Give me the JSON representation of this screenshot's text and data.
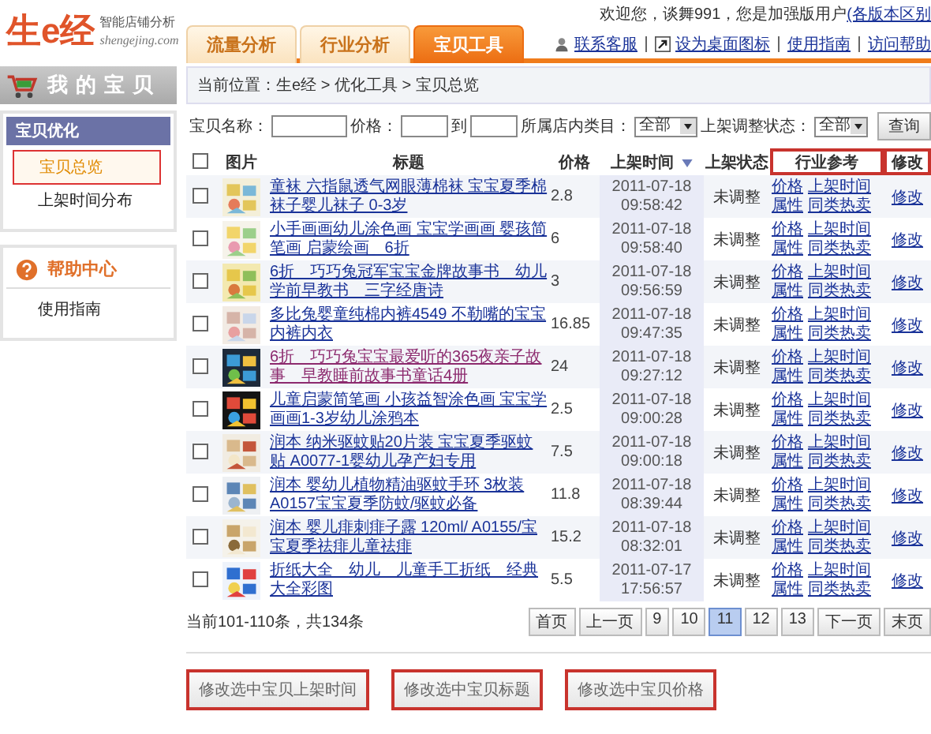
{
  "logo": {
    "name": "生e经",
    "tagline": "智能店铺分析",
    "domain": "shengejing.com"
  },
  "user_bar": {
    "welcome": "欢迎您，谈舞991，您是加强版用户",
    "link": "(各版本区别"
  },
  "top_links": [
    {
      "label": "联系客服",
      "kind": "contact"
    },
    {
      "label": "设为桌面图标",
      "kind": "shortcut"
    },
    {
      "label": "使用指南",
      "kind": "plain"
    },
    {
      "label": "访问帮助",
      "kind": "plain"
    }
  ],
  "tabs": [
    {
      "label": "流量分析",
      "selected": false
    },
    {
      "label": "行业分析",
      "selected": false
    },
    {
      "label": "宝贝工具",
      "selected": true
    }
  ],
  "sidebar": {
    "header": "我的宝贝",
    "sections": [
      {
        "title": "宝贝优化",
        "kind": "menu",
        "items": [
          {
            "label": "宝贝总览",
            "selected": true
          },
          {
            "label": "上架时间分布",
            "selected": false
          }
        ]
      },
      {
        "title": "帮助中心",
        "kind": "help",
        "items": [
          {
            "label": "使用指南",
            "selected": false
          }
        ]
      }
    ]
  },
  "breadcrumb": "当前位置：生e经 > 优化工具 > 宝贝总览",
  "search": {
    "name_label": "宝贝名称：",
    "price_label": "价格：",
    "price_to": "到",
    "category_label": "所属店内类目：",
    "category_value": "全部",
    "status_label": "上架调整状态：",
    "status_value": "全部",
    "button": "查询"
  },
  "table": {
    "header_checkbox": {
      "checked": false
    },
    "columns": [
      {
        "label": "图片",
        "highlighted": false,
        "sorted": false
      },
      {
        "label": "标题",
        "highlighted": false,
        "sorted": false
      },
      {
        "label": "价格",
        "highlighted": false,
        "sorted": false
      },
      {
        "label": "上架时间",
        "highlighted": false,
        "sorted": true
      },
      {
        "label": "上架状态",
        "highlighted": false,
        "sorted": false
      },
      {
        "label": "行业参考",
        "highlighted": true,
        "sorted": false
      },
      {
        "label": "修改",
        "highlighted": true,
        "sorted": false
      }
    ],
    "rows": [
      {
        "checked": false,
        "title": "童袜 六指鼠透气网眼薄棉袜 宝宝夏季棉袜子婴儿袜子 0-3岁",
        "visited": false,
        "price": "2.8",
        "date": "2011-07-18",
        "time": "09:58:42",
        "status": "未调整",
        "refs": [
          "价格",
          "上架时间",
          "属性",
          "同类热卖"
        ],
        "edit": "修改"
      },
      {
        "checked": false,
        "title": "小手画画幼儿涂色画 宝宝学画画 婴孩简笔画 启蒙绘画　6折",
        "visited": false,
        "price": "6",
        "date": "2011-07-18",
        "time": "09:58:40",
        "status": "未调整",
        "refs": [
          "价格",
          "上架时间",
          "属性",
          "同类热卖"
        ],
        "edit": "修改"
      },
      {
        "checked": false,
        "title": "6折　巧巧兔冠军宝宝金牌故事书　幼儿学前早教书　三字经唐诗",
        "visited": false,
        "price": "3",
        "date": "2011-07-18",
        "time": "09:56:59",
        "status": "未调整",
        "refs": [
          "价格",
          "上架时间",
          "属性",
          "同类热卖"
        ],
        "edit": "修改"
      },
      {
        "checked": false,
        "title": "多比兔婴童纯棉内裤4549 不勒嘴的宝宝内裤内衣",
        "visited": false,
        "price": "16.85",
        "date": "2011-07-18",
        "time": "09:47:35",
        "status": "未调整",
        "refs": [
          "价格",
          "上架时间",
          "属性",
          "同类热卖"
        ],
        "edit": "修改"
      },
      {
        "checked": false,
        "title": "6折　巧巧兔宝宝最爱听的365夜亲子故事　早教睡前故事书童话4册",
        "visited": true,
        "price": "24",
        "date": "2011-07-18",
        "time": "09:27:12",
        "status": "未调整",
        "refs": [
          "价格",
          "上架时间",
          "属性",
          "同类热卖"
        ],
        "edit": "修改"
      },
      {
        "checked": false,
        "title": "儿童启蒙简笔画 小孩益智涂色画 宝宝学画画1-3岁幼儿涂鸦本",
        "visited": false,
        "price": "2.5",
        "date": "2011-07-18",
        "time": "09:00:28",
        "status": "未调整",
        "refs": [
          "价格",
          "上架时间",
          "属性",
          "同类热卖"
        ],
        "edit": "修改"
      },
      {
        "checked": false,
        "title": "润本 纳米驱蚊贴20片装 宝宝夏季驱蚊贴 A0077-1婴幼儿孕产妇专用",
        "visited": false,
        "price": "7.5",
        "date": "2011-07-18",
        "time": "09:00:18",
        "status": "未调整",
        "refs": [
          "价格",
          "上架时间",
          "属性",
          "同类热卖"
        ],
        "edit": "修改"
      },
      {
        "checked": false,
        "title": "润本 婴幼儿植物精油驱蚊手环 3枚装 A0157宝宝夏季防蚊/驱蚊必备",
        "visited": false,
        "price": "11.8",
        "date": "2011-07-18",
        "time": "08:39:44",
        "status": "未调整",
        "refs": [
          "价格",
          "上架时间",
          "属性",
          "同类热卖"
        ],
        "edit": "修改"
      },
      {
        "checked": false,
        "title": "润本 婴儿痱刺痱子露 120ml/ A0155/宝宝夏季祛痱儿童祛痱",
        "visited": false,
        "price": "15.2",
        "date": "2011-07-18",
        "time": "08:32:01",
        "status": "未调整",
        "refs": [
          "价格",
          "上架时间",
          "属性",
          "同类热卖"
        ],
        "edit": "修改"
      },
      {
        "checked": false,
        "title": "折纸大全　幼儿　儿童手工折纸　经典大全彩图",
        "visited": false,
        "price": "5.5",
        "date": "2011-07-17",
        "time": "17:56:57",
        "status": "未调整",
        "refs": [
          "价格",
          "上架时间",
          "属性",
          "同类热卖"
        ],
        "edit": "修改"
      }
    ]
  },
  "count": "当前101-110条，共134条",
  "pagination": [
    {
      "label": "首页",
      "selected": false
    },
    {
      "label": "上一页",
      "selected": false
    },
    {
      "label": "9",
      "selected": false
    },
    {
      "label": "10",
      "selected": false
    },
    {
      "label": "11",
      "selected": true
    },
    {
      "label": "12",
      "selected": false
    },
    {
      "label": "13",
      "selected": false
    },
    {
      "label": "下一页",
      "selected": false
    },
    {
      "label": "末页",
      "selected": false
    }
  ],
  "buttons": [
    {
      "label": "修改选中宝贝上架时间",
      "highlighted": true
    },
    {
      "label": "修改选中宝贝标题",
      "highlighted": true
    },
    {
      "label": "修改选中宝贝价格",
      "highlighted": true
    }
  ]
}
